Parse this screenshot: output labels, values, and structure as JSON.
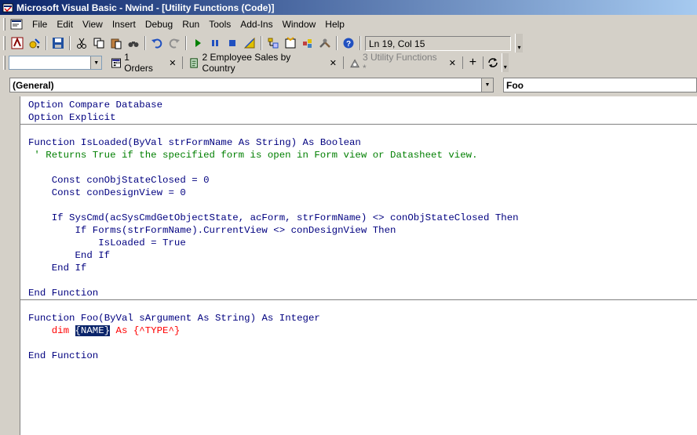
{
  "window": {
    "title": "Microsoft Visual Basic - Nwind - [Utility Functions (Code)]"
  },
  "menu": [
    "File",
    "Edit",
    "View",
    "Insert",
    "Debug",
    "Run",
    "Tools",
    "Add-Ins",
    "Window",
    "Help"
  ],
  "toolbar": {
    "buttons": [
      "access-view-icon",
      "insert-module-icon",
      "save-icon",
      "cut-icon",
      "copy-icon",
      "paste-icon",
      "find-icon",
      "undo-icon",
      "redo-icon",
      "run-icon",
      "break-icon",
      "reset-icon",
      "design-mode-icon",
      "project-explorer-icon",
      "properties-window-icon",
      "object-browser-icon",
      "toolbox-icon",
      "help-icon"
    ],
    "position": "Ln 19, Col 15"
  },
  "tabs": [
    {
      "label": "1 Orders",
      "active": true
    },
    {
      "label": "2 Employee Sales by Country",
      "active": true
    },
    {
      "label": "3 Utility Functions *",
      "active": false
    }
  ],
  "combos": {
    "object": "(General)",
    "procedure": "Foo"
  },
  "code": {
    "l1": "Option Compare Database",
    "l2": "Option Explicit",
    "l3a": "Function",
    "l3b": " IsLoaded(",
    "l3c": "ByVal",
    "l3d": " strFormName ",
    "l3e": "As String",
    "l3f": ") ",
    "l3g": "As Boolean",
    "l4": " ' Returns True if the specified form is open in Form view or Datasheet view.",
    "l5a": "    Const",
    "l5b": " conObjStateClosed = 0",
    "l6a": "    Const",
    "l6b": " conDesignView = 0",
    "l7a": "    If",
    "l7b": " SysCmd(acSysCmdGetObjectState, acForm, strFormName) <> conObjStateClosed ",
    "l7c": "Then",
    "l8a": "        If",
    "l8b": " Forms(strFormName).CurrentView <> conDesignView ",
    "l8c": "Then",
    "l9a": "            IsLoaded = ",
    "l9b": "True",
    "l10a": "        End If",
    "l11a": "    End If",
    "l12": "End Function",
    "l13a": "Function",
    "l13b": " Foo(",
    "l13c": "ByVal",
    "l13d": " sArgument ",
    "l13e": "As String",
    "l13f": ") ",
    "l13g": "As Integer",
    "l14a": "    dim ",
    "l14b": "{NAME}",
    "l14c": " As {^TYPE^}",
    "l15": "End Function"
  }
}
